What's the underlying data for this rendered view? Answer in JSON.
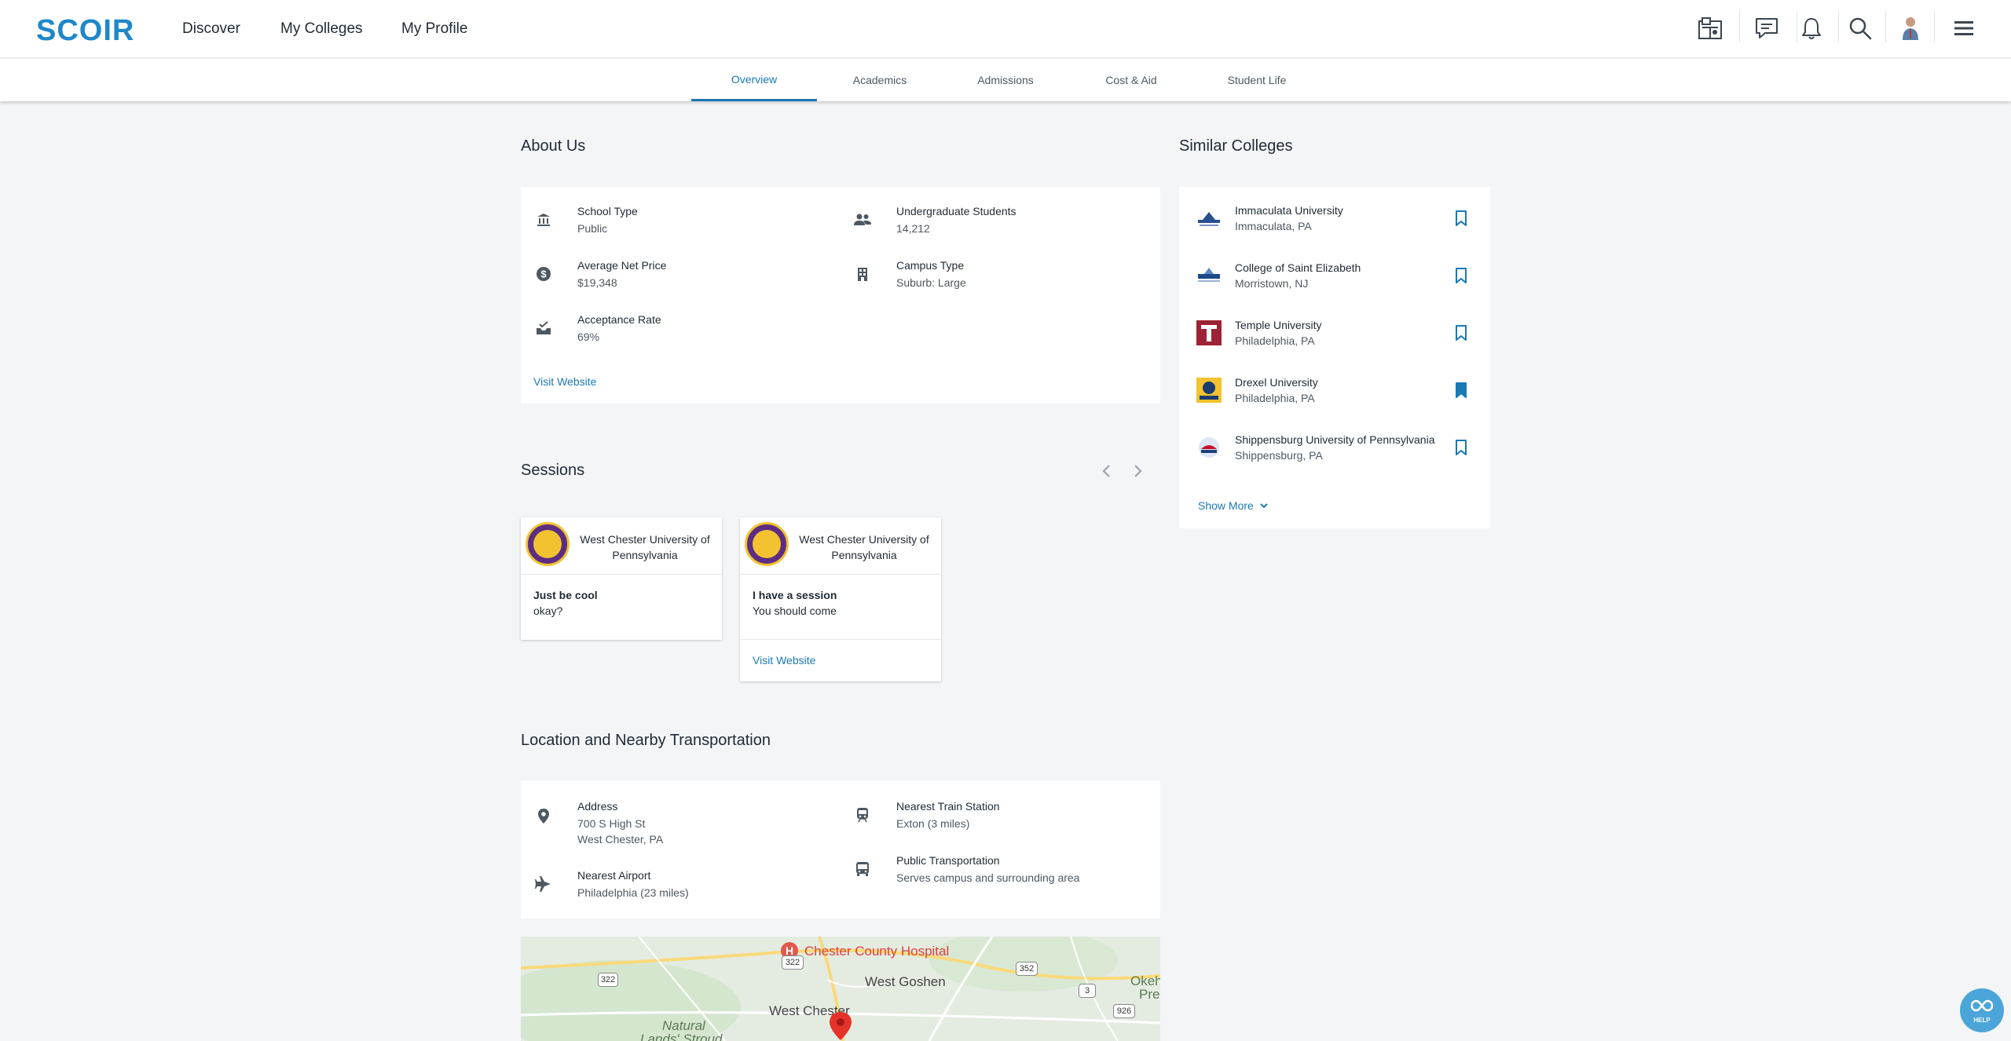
{
  "nav": {
    "logo": "SCOIR",
    "links": [
      "Discover",
      "My Colleges",
      "My Profile"
    ]
  },
  "tabs": [
    "Overview",
    "Academics",
    "Admissions",
    "Cost & Aid",
    "Student Life"
  ],
  "about": {
    "title": "About Us",
    "facts_left": [
      {
        "label": "School Type",
        "value": "Public",
        "icon": "bank-icon"
      },
      {
        "label": "Average Net Price",
        "value": "$19,348",
        "icon": "dollar-icon"
      },
      {
        "label": "Acceptance Rate",
        "value": "69%",
        "icon": "inbox-icon"
      }
    ],
    "facts_right": [
      {
        "label": "Undergraduate Students",
        "value": "14,212",
        "icon": "people-icon"
      },
      {
        "label": "Campus Type",
        "value": "Suburb: Large",
        "icon": "building-icon"
      }
    ],
    "visit_website": "Visit Website"
  },
  "sessions": {
    "title": "Sessions",
    "items": [
      {
        "university": "West Chester University of Pennsylvania",
        "title": "Just be cool",
        "description": "okay?"
      },
      {
        "university": "West Chester University of Pennsylvania",
        "title": "I have a session",
        "description": "You should come",
        "link": "Visit Website"
      }
    ]
  },
  "location": {
    "title": "Location and Nearby Transportation",
    "address_label": "Address",
    "address_line1": "700 S High St",
    "address_line2": "West Chester, PA",
    "airport_label": "Nearest Airport",
    "airport_value": "Philadelphia (23 miles)",
    "train_label": "Nearest Train Station",
    "train_value": "Exton (3 miles)",
    "transit_label": "Public Transportation",
    "transit_value": "Serves campus and surrounding area"
  },
  "map": {
    "hospital": "Chester County Hospital",
    "west_goshen": "West Goshen",
    "west_chester": "West Chester",
    "natural_lands": "Natural",
    "lands_stroud": "Lands' Stroud",
    "okeh": "Okeh",
    "pre": "Pre",
    "route_322_a": "322",
    "route_322_b": "322",
    "route_352": "352",
    "route_3": "3",
    "route_926": "926"
  },
  "similar": {
    "title": "Similar Colleges",
    "items": [
      {
        "name": "Immaculata University",
        "location": "Immaculata, PA",
        "saved": false
      },
      {
        "name": "College of Saint Elizabeth",
        "location": "Morristown, NJ",
        "saved": false
      },
      {
        "name": "Temple University",
        "location": "Philadelphia, PA",
        "saved": false
      },
      {
        "name": "Drexel University",
        "location": "Philadelphia, PA",
        "saved": true
      },
      {
        "name": "Shippensburg University of Pennsylvania",
        "location": "Shippensburg, PA",
        "saved": false
      }
    ],
    "show_more": "Show More"
  },
  "help": {
    "label": "HELP"
  },
  "colors": {
    "brand": "#1f87c9",
    "accent": "#1a78b4",
    "temple": "#9d2235",
    "drexel": "#f2c230"
  }
}
